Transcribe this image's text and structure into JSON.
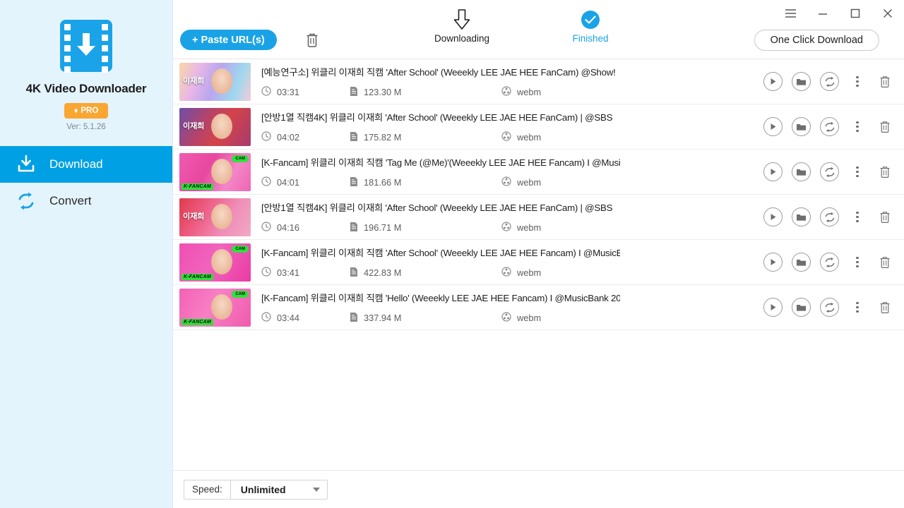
{
  "sidebar": {
    "logo_icon": "film-download-icon",
    "brand_name": "4K Video Downloader",
    "pro_badge": {
      "gem_icon": "gem-icon",
      "label": "PRO"
    },
    "version": "Ver: 5.1.26",
    "items": [
      {
        "label": "Download",
        "icon": "download-tray-icon",
        "active": true
      },
      {
        "label": "Convert",
        "icon": "convert-loop-icon",
        "active": false
      }
    ]
  },
  "titlebar": {
    "menu_icon": "hamburger-menu-icon",
    "minimize_icon": "minimize-icon",
    "maximize_icon": "maximize-icon",
    "close_icon": "close-icon"
  },
  "toolbar": {
    "paste_label": "+ Paste URL(s)",
    "trash_icon": "trash-icon",
    "one_click_label": "One Click Download",
    "tabs": [
      {
        "label": "Downloading",
        "icon": "down-arrow-outline-icon",
        "active": false
      },
      {
        "label": "Finished",
        "icon": "check-circle-icon",
        "active": true
      }
    ]
  },
  "list": {
    "action_icons": [
      "play-icon",
      "folder-icon",
      "convert-loop-icon",
      "kebab-menu-icon",
      "trash-icon"
    ],
    "meta_icons": {
      "duration": "clock-icon",
      "size": "file-icon",
      "format": "film-reel-icon"
    },
    "rows": [
      {
        "title": "[예능연구소] 위클리 이재희 직캠 'After School' (Weeekly LEE JAE HEE FanCam) @Show!",
        "duration": "03:31",
        "size": "123.30 M",
        "format": "webm",
        "thumb": {
          "bg": "linear-gradient(110deg,#f7d8a4 0%,#e9b7e7 25%,#b9a6ee 50%,#9fd8ef 78%,#f3cbd6 100%)",
          "hangul": "이재희",
          "tag": "",
          "cam": ""
        }
      },
      {
        "title": "[안방1열 직캠4K] 위클리 이재희 'After School' (Weeekly LEE JAE HEE FanCam) | @SBS",
        "duration": "04:02",
        "size": "175.82 M",
        "format": "webm",
        "thumb": {
          "bg": "linear-gradient(120deg,#6c4fa8 0%,#b4436b 35%,#d4434a 60%,#a73b6e 100%)",
          "hangul": "이재희",
          "tag": "",
          "cam": ""
        }
      },
      {
        "title": "[K-Fancam] 위클리 이재희 직캠 'Tag Me (@Me)'(Weeekly LEE JAE HEE Fancam) I @Musi",
        "duration": "04:01",
        "size": "181.66 M",
        "format": "webm",
        "thumb": {
          "bg": "linear-gradient(120deg,#f05ab0 0%,#e8479f 40%,#f386c6 70%,#ef64b4 100%)",
          "hangul": "",
          "tag": "K-FANCAM",
          "cam": "CAM"
        }
      },
      {
        "title": "[안방1열 직캠4K] 위클리 이재희 'After School' (Weeekly LEE JAE HEE FanCam) | @SBS",
        "duration": "04:16",
        "size": "196.71 M",
        "format": "webm",
        "thumb": {
          "bg": "linear-gradient(120deg,#e03a4b 0%,#ee5f86 35%,#f08cb6 65%,#f1a9c6 100%)",
          "hangul": "이재희",
          "tag": "",
          "cam": ""
        }
      },
      {
        "title": "[K-Fancam] 위클리 이재희 직캠 'After School' (Weeekly LEE JAE HEE Fancam) I @MusicB",
        "duration": "03:41",
        "size": "422.83 M",
        "format": "webm",
        "thumb": {
          "bg": "linear-gradient(120deg,#ef4fb2 0%,#f163bd 45%,#ea3ba4 100%)",
          "hangul": "",
          "tag": "K-FANCAM",
          "cam": "CAM"
        }
      },
      {
        "title": "[K-Fancam] 위클리 이재희 직캠 'Hello' (Weeekly LEE JAE HEE  Fancam) I @MusicBank 20",
        "duration": "03:44",
        "size": "337.94 M",
        "format": "webm",
        "thumb": {
          "bg": "linear-gradient(120deg,#f361b5 0%,#f87fc4 45%,#f05aae 100%)",
          "hangul": "",
          "tag": "K-FANCAM",
          "cam": "CAM"
        }
      }
    ]
  },
  "bottombar": {
    "speed_label": "Speed:",
    "speed_value": "Unlimited",
    "caret_icon": "chevron-down-icon"
  },
  "colors": {
    "accent": "#19a3e6",
    "sidebar_bg": "#e4f4fd",
    "sidebar_active": "#00a0e4",
    "pro_orange": "#f9a633"
  }
}
